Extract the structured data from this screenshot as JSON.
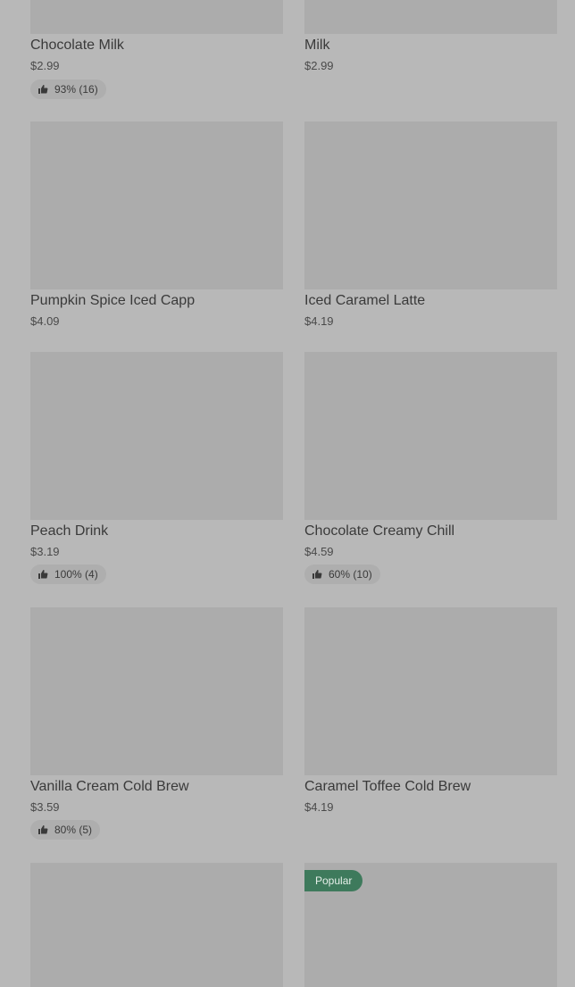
{
  "products": [
    {
      "name": "Chocolate Milk",
      "price": "$2.99",
      "rating": "93% (16)"
    },
    {
      "name": "Milk",
      "price": "$2.99"
    },
    {
      "name": "Pumpkin Spice Iced Capp",
      "price": "$4.09"
    },
    {
      "name": "Iced Caramel Latte",
      "price": "$4.19"
    },
    {
      "name": "Peach Drink",
      "price": "$3.19",
      "rating": "100% (4)"
    },
    {
      "name": "Chocolate Creamy Chill",
      "price": "$4.59",
      "rating": "60% (10)"
    },
    {
      "name": "Vanilla Cream Cold Brew",
      "price": "$3.59",
      "rating": "80% (5)"
    },
    {
      "name": "Caramel Toffee Cold Brew",
      "price": "$4.19"
    },
    {},
    {
      "badge": "Popular"
    }
  ],
  "icons": {
    "rating": "thumbs-up-icon"
  },
  "colors": {
    "background": "#b8b8b8",
    "image_placeholder": "#acacac",
    "popular_badge": "#3e7a5c"
  }
}
